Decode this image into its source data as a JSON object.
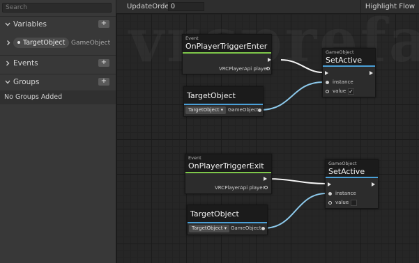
{
  "sidebar": {
    "search_placeholder": "Search",
    "sections": {
      "variables": {
        "title": "Variables",
        "add_label": "+"
      },
      "events": {
        "title": "Events",
        "add_label": "+"
      },
      "groups": {
        "title": "Groups",
        "add_label": "+"
      }
    },
    "variable": {
      "name": "TargetObject",
      "type": "GameObject"
    },
    "groups_empty": "No Groups Added"
  },
  "toolbar": {
    "update_order_label": "UpdateOrder",
    "update_order_value": "0",
    "highlight_flow": "Highlight Flow"
  },
  "watermark": "vrcprefabs",
  "nodes": {
    "enter_event": {
      "category": "Event",
      "title": "OnPlayerTriggerEnter",
      "param": "VRCPlayerApi player"
    },
    "exit_event": {
      "category": "Event",
      "title": "OnPlayerTriggerExit",
      "param": "VRCPlayerApi player"
    },
    "set_active_1": {
      "category": "GameObject",
      "title": "SetActive",
      "instance": "instance",
      "value": "value",
      "checked_mark": "✓"
    },
    "set_active_2": {
      "category": "GameObject",
      "title": "SetActive",
      "instance": "instance",
      "value": "value"
    },
    "target_1": {
      "title": "TargetObject",
      "dropdown": "TargetObject ▾",
      "output": "GameObject"
    },
    "target_2": {
      "title": "TargetObject",
      "dropdown": "TargetObject ▾",
      "output": "GameObject"
    }
  },
  "colors": {
    "event_accent": "#7ec84a",
    "variable_accent": "#4aa0d8",
    "flow_wire": "#ffffff",
    "data_wire": "#8cc8ea"
  },
  "icons": [
    "chevron-down-icon",
    "chevron-right-icon",
    "flow-arrow-icon",
    "port-circle-icon",
    "checkmark-icon"
  ]
}
